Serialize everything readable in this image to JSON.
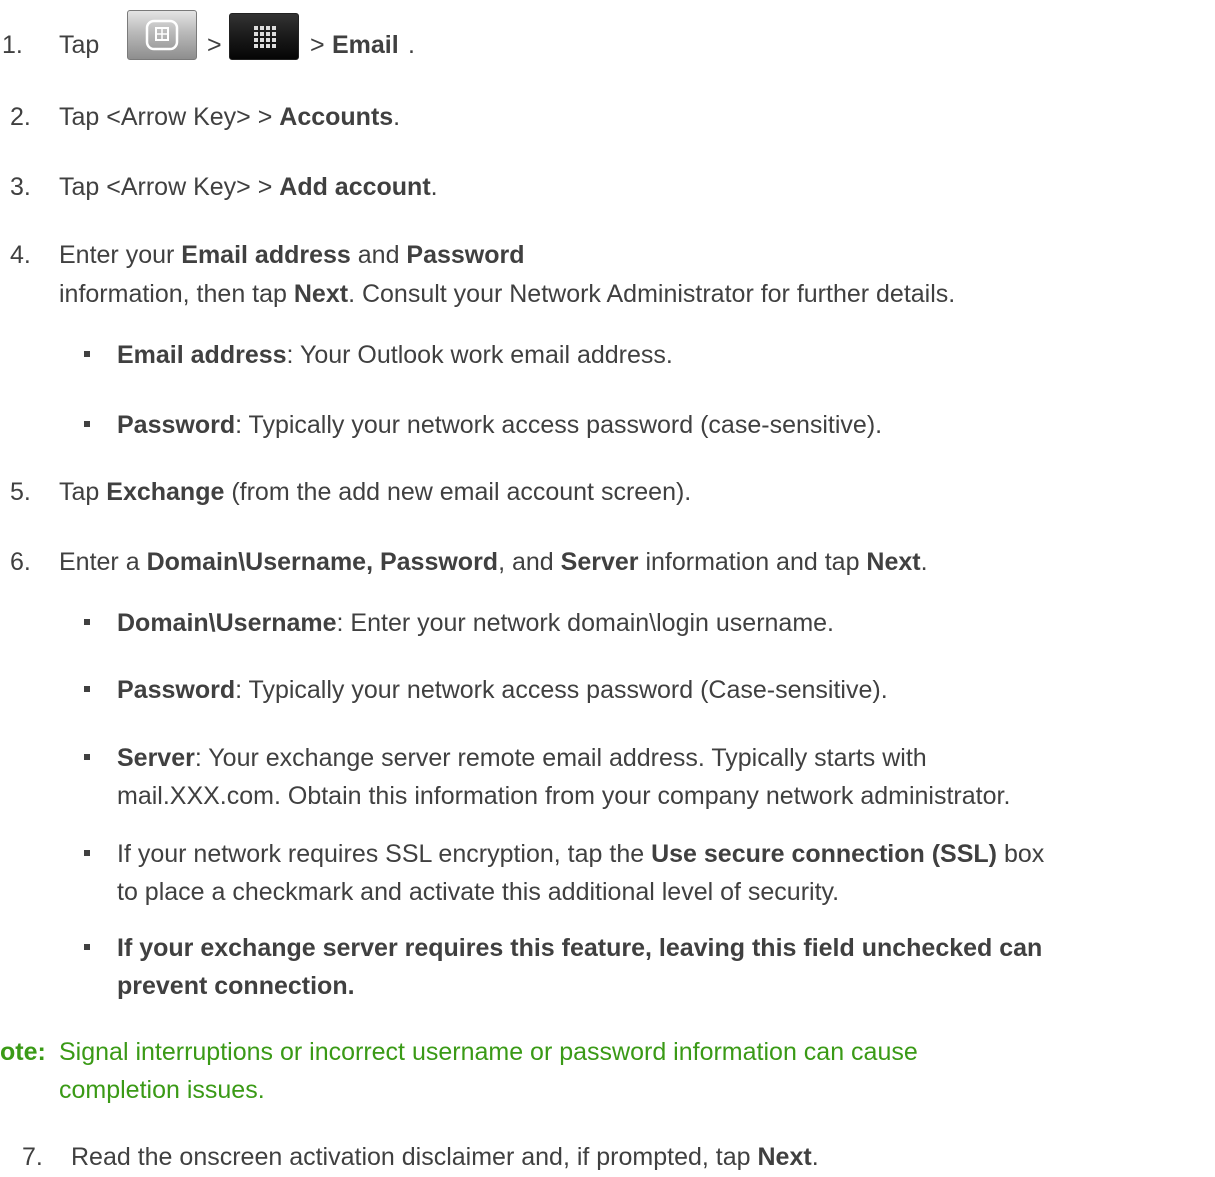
{
  "steps": {
    "s1": {
      "num": "1.",
      "tap": "Tap",
      "gt1": ">",
      "gt2": ">",
      "email": "Email",
      "end": "."
    },
    "s2": {
      "num": "2.",
      "pre": "Tap <Arrow Key> > ",
      "bold": "Accounts",
      "end": "."
    },
    "s3": {
      "num": "3.",
      "pre": "Tap <Arrow Key> > ",
      "bold": "Add account",
      "end": "."
    },
    "s4": {
      "num": "4.",
      "l1_pre": "Enter your ",
      "l1_b1": "Email address",
      "l1_mid": " and ",
      "l1_b2": "Password",
      "l2_pre": "information, then tap ",
      "l2_b": "Next",
      "l2_post": ". Consult your Network Administrator for further details.",
      "bullets": [
        {
          "bold": "Email address",
          "text": ": Your Outlook work email address."
        },
        {
          "bold": "Password",
          "text": ": Typically your network access password (case-sensitive)."
        }
      ]
    },
    "s5": {
      "num": "5.",
      "pre": "Tap ",
      "bold": "Exchange",
      "post": " (from the add new email account screen)."
    },
    "s6": {
      "num": "6.",
      "pre": "Enter a ",
      "b1": "Domain\\Username, Password",
      "mid1": ", and ",
      "b2": "Server",
      "mid2": " information and tap ",
      "b3": "Next",
      "end": ".",
      "bullets": {
        "b1": {
          "bold": "Domain\\Username",
          "text": ": Enter your network domain\\login username."
        },
        "b2": {
          "bold": "Password",
          "text": ": Typically your network access password (Case-sensitive)."
        },
        "b3": {
          "bold": "Server",
          "l1": ": Your exchange server remote email address. Typically starts with",
          "l2": "mail.XXX.com. Obtain this information from your company network administrator."
        },
        "b4": {
          "l1_pre": "If your network requires SSL encryption, tap the ",
          "l1_bold": "Use secure connection (SSL)",
          "l1_post": " box",
          "l2": "to place a checkmark and activate this additional level of security."
        },
        "b5": {
          "l1": "If your exchange server requires this feature, leaving this field unchecked can",
          "l2": "prevent connection."
        }
      }
    },
    "note": {
      "label": "ote",
      "colon": ":",
      "l1": "Signal interruptions or incorrect username or password information can cause",
      "l2": "completion issues."
    },
    "s7": {
      "num": "7.",
      "pre": "Read the onscreen activation disclaimer and, if prompted, tap ",
      "bold": "Next",
      "end": "."
    }
  },
  "icons": {
    "home_key": "home-key-icon",
    "apps_key": "apps-grid-icon"
  },
  "colors": {
    "body_text": "#404040",
    "note_green": "#3a9a16"
  }
}
